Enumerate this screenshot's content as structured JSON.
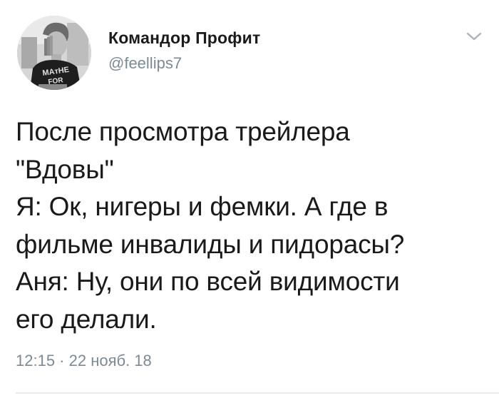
{
  "tweet": {
    "author": {
      "display_name": "Командор Профит",
      "handle": "@feellips7",
      "avatar_icon": "user-avatar-photo",
      "avatar_shirt_text": "MATHE FOR"
    },
    "menu_icon": "chevron-down-icon",
    "text": "После просмотра трейлера\n\"Вдовы\"\nЯ: Ок, нигеры и фемки. А где в\nфильме инвалиды и пидорасы?\nАня: Ну, они по всей видимости\nего делали.",
    "timestamp": "12:15 · 22 нояб. 18"
  },
  "colors": {
    "name": "#1b1b1b",
    "secondary": "#7c8a96",
    "text": "#1a1a1a",
    "divider": "#e6ecf0",
    "background": "#ffffff"
  }
}
